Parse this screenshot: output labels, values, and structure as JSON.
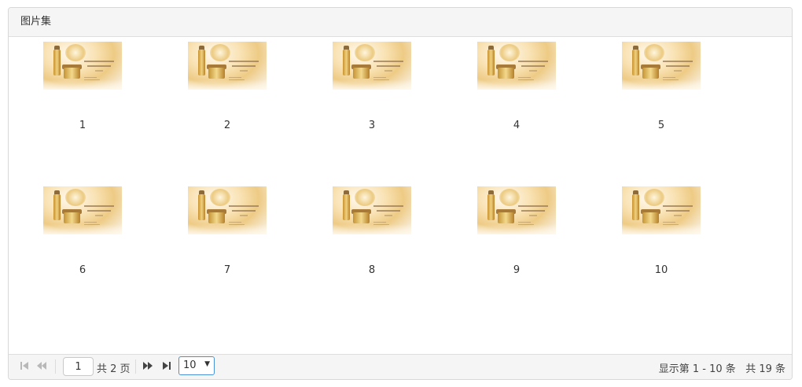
{
  "panel": {
    "title": "图片集"
  },
  "gallery": {
    "items": [
      {
        "label": "1"
      },
      {
        "label": "2"
      },
      {
        "label": "3"
      },
      {
        "label": "4"
      },
      {
        "label": "5"
      },
      {
        "label": "6"
      },
      {
        "label": "7"
      },
      {
        "label": "8"
      },
      {
        "label": "9"
      },
      {
        "label": "10"
      }
    ]
  },
  "pager": {
    "current_page": "1",
    "total_pages_text": "共 2 页",
    "page_size": "10",
    "range_text": "显示第 1 - 10 条",
    "total_text": "共 19 条",
    "icons": {
      "first": "first-page-icon",
      "prev": "prev-page-icon",
      "next": "next-page-icon",
      "last": "last-page-icon",
      "dropdown": "caret-down-icon"
    }
  }
}
